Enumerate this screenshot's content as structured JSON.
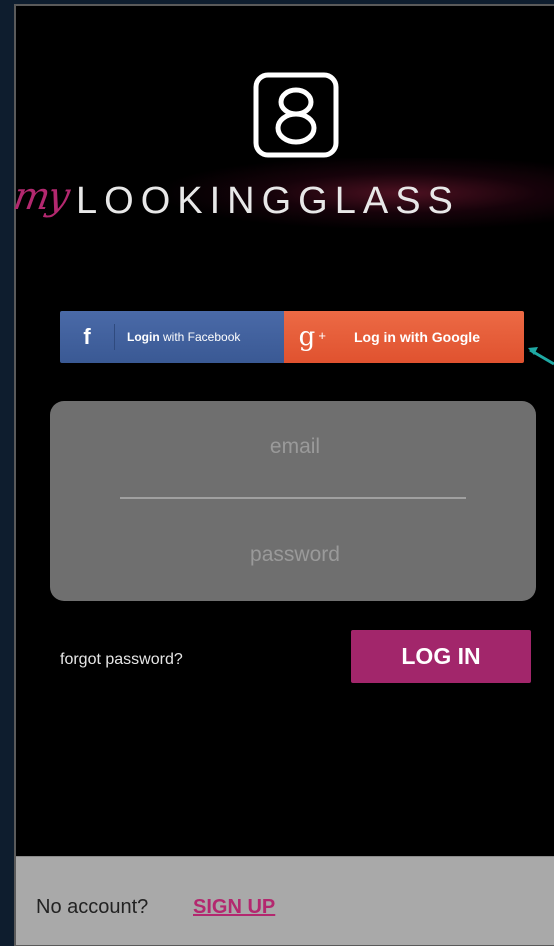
{
  "brand": {
    "script": "my",
    "name": "LOOKINGGLASS",
    "accent_color": "#b3286f"
  },
  "social": {
    "facebook_icon": "f",
    "facebook_label_bold": "Login",
    "facebook_label_rest": " with Facebook",
    "google_icon": "g",
    "google_icon_sup": "+",
    "google_label": "Log in with Google"
  },
  "form": {
    "email_placeholder": "email",
    "password_placeholder": "password",
    "forgot_label": "forgot password?",
    "login_label": "LOG IN"
  },
  "footer": {
    "prompt": "No account?",
    "signup_label": "SIGN UP"
  },
  "icons": {
    "logo": "eight-rounded-square-icon",
    "arrow": "teal-arrow-icon"
  }
}
